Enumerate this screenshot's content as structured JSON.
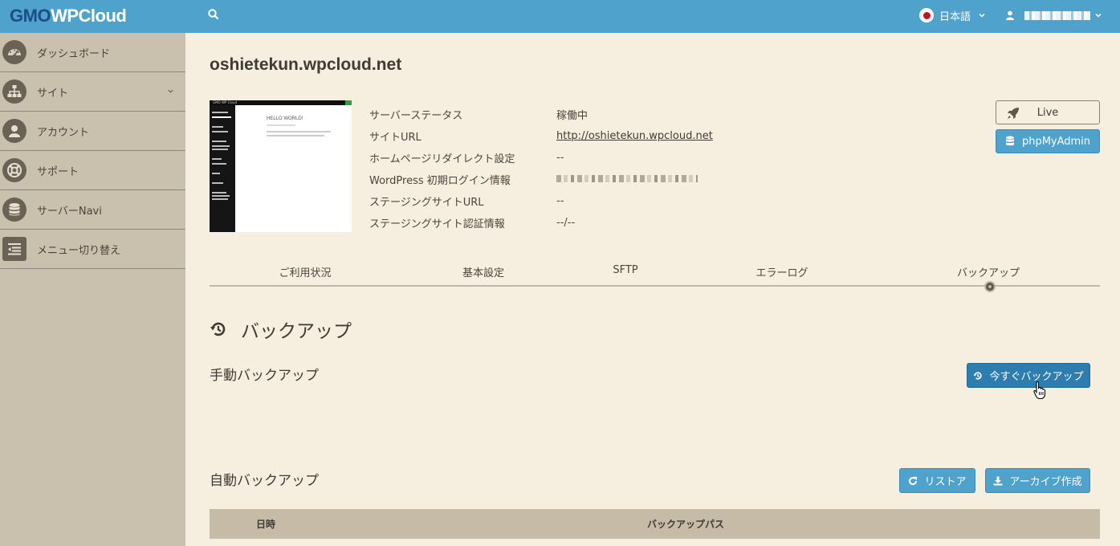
{
  "header": {
    "logo_main": "GMO",
    "logo_accent": "WPCloud",
    "language": "日本語",
    "search_icon": "search-icon",
    "user_icon": "user-icon"
  },
  "sidebar": {
    "items": [
      {
        "label": "ダッシュボード",
        "icon": "dashboard-icon"
      },
      {
        "label": "サイト",
        "icon": "sitemap-icon",
        "has_submenu": true
      },
      {
        "label": "アカウント",
        "icon": "user-icon"
      },
      {
        "label": "サポート",
        "icon": "lifebuoy-icon"
      },
      {
        "label": "サーバーNavi",
        "icon": "database-icon"
      },
      {
        "label": "メニュー切り替え",
        "icon": "menu-toggle-icon"
      }
    ]
  },
  "site": {
    "title": "oshietekun.wpcloud.net",
    "thumbnail": {
      "site_name": "GMO WP Cloud",
      "heading": "HELLO WORLD!"
    },
    "info": [
      {
        "key": "サーバーステータス",
        "value": "稼働中"
      },
      {
        "key": "サイトURL",
        "value": "http://oshietekun.wpcloud.net",
        "link": true
      },
      {
        "key": "ホームページリダイレクト設定",
        "value": "--"
      },
      {
        "key": "WordPress 初期ログイン情報",
        "value": "",
        "masked": true
      },
      {
        "key": "ステージングサイトURL",
        "value": "--"
      },
      {
        "key": "ステージングサイト認証情報",
        "value": "--/--"
      }
    ],
    "buttons": {
      "live": "Live",
      "phpmyadmin": "phpMyAdmin"
    }
  },
  "tabs": [
    {
      "label": "ご利用状況",
      "active": false
    },
    {
      "label": "基本設定",
      "active": false
    },
    {
      "label": "SFTP",
      "active": false
    },
    {
      "label": "エラーログ",
      "active": false
    },
    {
      "label": "バックアップ",
      "active": true
    }
  ],
  "backup": {
    "title": "バックアップ",
    "manual_title": "手動バックアップ",
    "backup_now": "今すぐバックアップ",
    "auto_title": "自動バックアップ",
    "restore": "リストア",
    "archive": "アーカイブ作成",
    "table_headers": [
      "日時",
      "バックアップパス"
    ]
  },
  "colors": {
    "topbar": "#4ea2cc",
    "sidebar": "#c9c0ad",
    "main_bg": "#f6efdf",
    "primary": "#4ea2cc",
    "logo_dark": "#1b4e86"
  }
}
